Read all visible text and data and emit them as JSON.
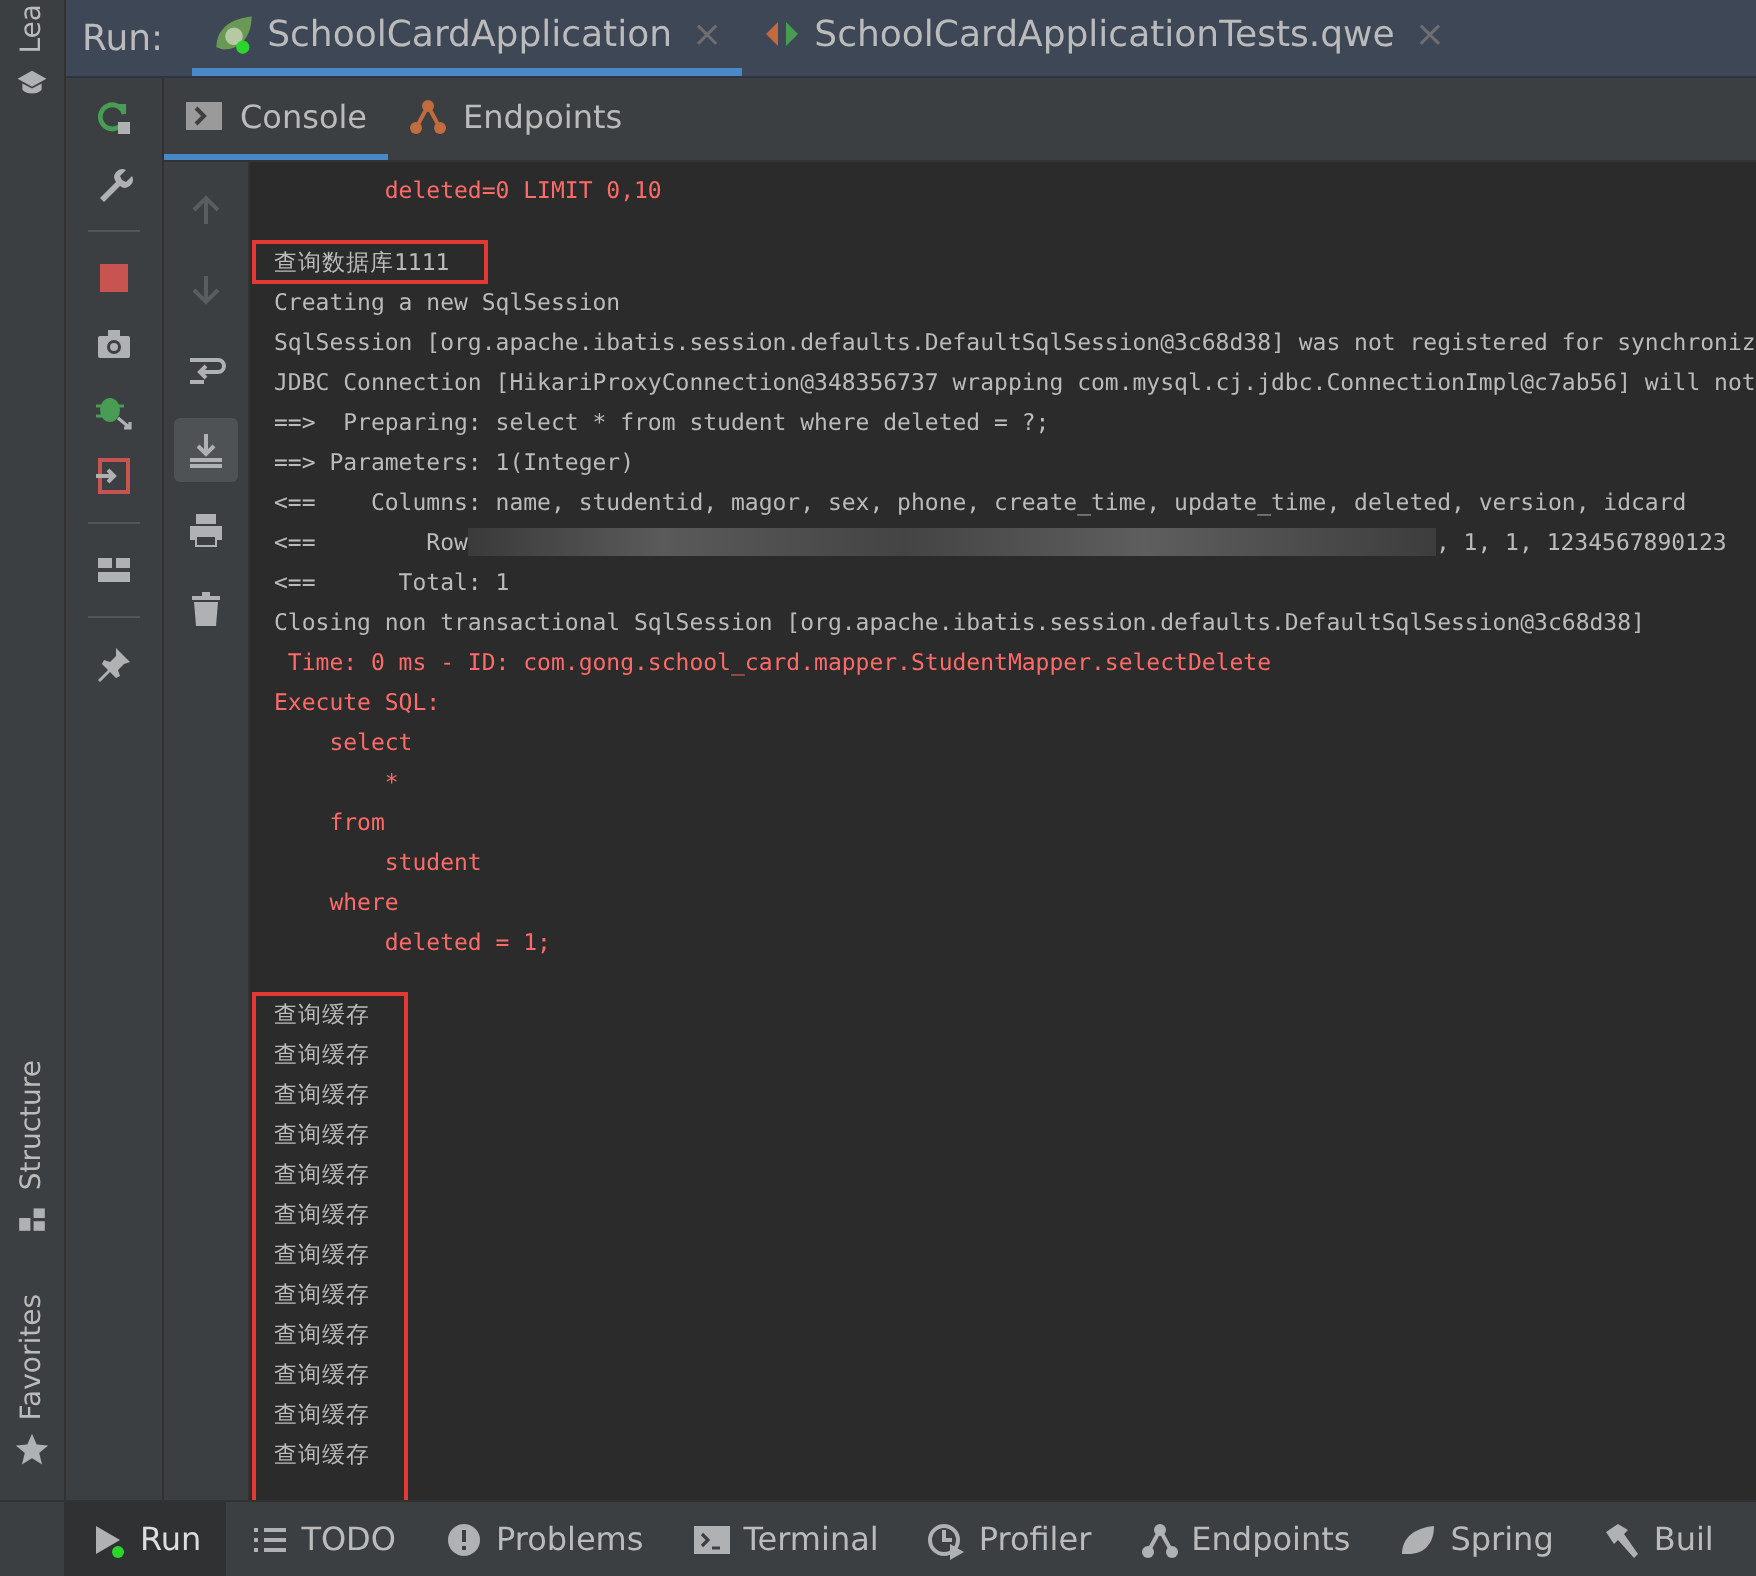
{
  "side_strip": {
    "items": [
      {
        "label": "Lea",
        "kind": "learn"
      },
      {
        "label": "Structure",
        "kind": "structure"
      },
      {
        "label": "Favorites",
        "kind": "favorites"
      }
    ]
  },
  "run_bar": {
    "label": "Run:",
    "tabs": [
      {
        "title": "SchoolCardApplication",
        "kind": "spring",
        "selected": true,
        "close": "×"
      },
      {
        "title": "SchoolCardApplicationTests.qwe",
        "kind": "test",
        "selected": false,
        "close": "×"
      }
    ]
  },
  "sub_tabs": [
    {
      "label": "Console",
      "kind": "console",
      "selected": true
    },
    {
      "label": "Endpoints",
      "kind": "endpoints",
      "selected": false
    }
  ],
  "left_tools": [
    {
      "kind": "rerun"
    },
    {
      "kind": "wrench"
    },
    {
      "kind": "stop"
    },
    {
      "kind": "camera"
    },
    {
      "kind": "bug"
    },
    {
      "kind": "exit"
    },
    {
      "kind": "layout"
    },
    {
      "kind": "pin"
    }
  ],
  "console_tools": [
    {
      "kind": "up",
      "disabled": true,
      "selected": false
    },
    {
      "kind": "down",
      "disabled": true,
      "selected": false
    },
    {
      "kind": "wrap",
      "disabled": false,
      "selected": false
    },
    {
      "kind": "scroll-end",
      "disabled": false,
      "selected": true
    },
    {
      "kind": "print",
      "disabled": false,
      "selected": false
    },
    {
      "kind": "trash",
      "disabled": false,
      "selected": false
    }
  ],
  "console": {
    "segments": [
      {
        "highlighted": false,
        "gap_before": false,
        "lines": [
          {
            "kind": "sql",
            "text": "        deleted=0 LIMIT 0,10"
          }
        ]
      },
      {
        "highlighted": true,
        "gap_before": true,
        "lines": [
          {
            "kind": "log",
            "text": "查询数据库1111"
          }
        ]
      },
      {
        "highlighted": false,
        "gap_before": false,
        "lines": [
          {
            "kind": "log",
            "text": "Creating a new SqlSession"
          },
          {
            "kind": "log",
            "text": "SqlSession [org.apache.ibatis.session.defaults.DefaultSqlSession@3c68d38] was not registered for synchroniz"
          },
          {
            "kind": "log",
            "text": "JDBC Connection [HikariProxyConnection@348356737 wrapping com.mysql.cj.jdbc.ConnectionImpl@c7ab56] will not"
          },
          {
            "kind": "log",
            "text": "==>  Preparing: select * from student where deleted = ?;"
          },
          {
            "kind": "log",
            "text": "==> Parameters: 1(Integer)"
          },
          {
            "kind": "log",
            "text": "<==    Columns: name, studentid, magor, sex, phone, create_time, update_time, deleted, version, idcard"
          },
          {
            "kind": "redacted",
            "text": "<==        Row",
            "after": ", 1, 1, 1234567890123"
          },
          {
            "kind": "log",
            "text": "<==      Total: 1"
          },
          {
            "kind": "log",
            "text": "Closing non transactional SqlSession [org.apache.ibatis.session.defaults.DefaultSqlSession@3c68d38]"
          },
          {
            "kind": "sql",
            "text": " Time: 0 ms - ID: com.gong.school_card.mapper.StudentMapper.selectDelete"
          },
          {
            "kind": "sql",
            "text": "Execute SQL:"
          },
          {
            "kind": "sql",
            "text": "    select"
          },
          {
            "kind": "sql",
            "text": "        *"
          },
          {
            "kind": "sql",
            "text": "    from"
          },
          {
            "kind": "sql",
            "text": "        student"
          },
          {
            "kind": "sql",
            "text": "    where"
          },
          {
            "kind": "sql",
            "text": "        deleted = 1;"
          }
        ]
      },
      {
        "highlighted": true,
        "gap_before": true,
        "lines": [
          {
            "kind": "log",
            "text": "查询缓存"
          },
          {
            "kind": "log",
            "text": "查询缓存"
          },
          {
            "kind": "log",
            "text": "查询缓存"
          },
          {
            "kind": "log",
            "text": "查询缓存"
          },
          {
            "kind": "log",
            "text": "查询缓存"
          },
          {
            "kind": "log",
            "text": "查询缓存"
          },
          {
            "kind": "log",
            "text": "查询缓存"
          },
          {
            "kind": "log",
            "text": "查询缓存"
          },
          {
            "kind": "log",
            "text": "查询缓存"
          },
          {
            "kind": "log",
            "text": "查询缓存"
          },
          {
            "kind": "log",
            "text": "查询缓存"
          },
          {
            "kind": "log",
            "text": "查询缓存"
          }
        ]
      }
    ]
  },
  "bottom_bar": [
    {
      "label": "Run",
      "kind": "run",
      "selected": true
    },
    {
      "label": "TODO",
      "kind": "todo",
      "selected": false
    },
    {
      "label": "Problems",
      "kind": "problems",
      "selected": false
    },
    {
      "label": "Terminal",
      "kind": "terminal",
      "selected": false
    },
    {
      "label": "Profiler",
      "kind": "profiler",
      "selected": false
    },
    {
      "label": "Endpoints",
      "kind": "endpoints",
      "selected": false
    },
    {
      "label": "Spring",
      "kind": "spring",
      "selected": false
    },
    {
      "label": "Buil",
      "kind": "build",
      "selected": false
    }
  ]
}
